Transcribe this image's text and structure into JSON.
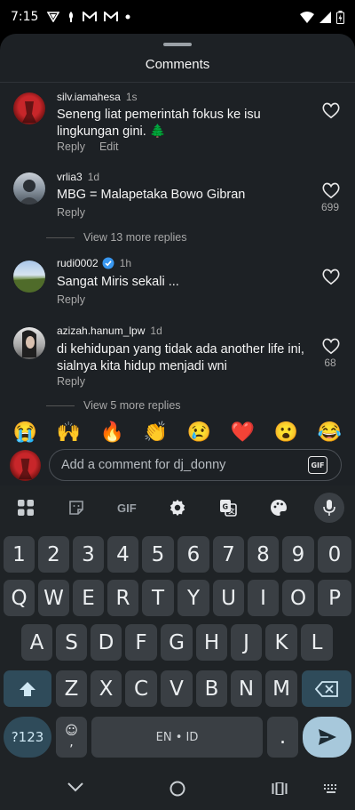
{
  "status": {
    "time": "7:15",
    "left_icons": [
      "vpn-icon",
      "notification-icon",
      "gmail-icon",
      "gmail-icon",
      "dot-icon"
    ]
  },
  "sheet": {
    "title": "Comments"
  },
  "comments": [
    {
      "user": "silv.iamahesa",
      "time": "1s",
      "text": "Seneng liat pemerintah fokus ke isu lingkungan gini. 🌲",
      "reply": "Reply",
      "edit": "Edit",
      "likes": ""
    },
    {
      "user": "vrlia3",
      "time": "1d",
      "text": "MBG = Malapetaka Bowo Gibran",
      "reply": "Reply",
      "likes": "699",
      "view_replies": "View 13 more replies"
    },
    {
      "user": "rudi0002",
      "time": "1h",
      "text": "Sangat Miris sekali ...",
      "reply": "Reply",
      "likes": "",
      "verified": true
    },
    {
      "user": "azizah.hanum_lpw",
      "time": "1d",
      "text": "di kehidupan yang tidak ada another life ini, sialnya kita hidup menjadi wni",
      "reply": "Reply",
      "likes": "68",
      "view_replies": "View 5 more replies"
    }
  ],
  "emojis": [
    "😭",
    "🙌",
    "🔥",
    "👏",
    "😢",
    "❤️",
    "😮",
    "😂"
  ],
  "input": {
    "placeholder": "Add a comment for dj_donny",
    "gif_label": "GIF"
  },
  "keyboard": {
    "toolbar": [
      "apps-icon",
      "sticker-icon",
      "GIF",
      "settings-icon",
      "translate-icon",
      "palette-icon",
      "mic-icon"
    ],
    "gif_text": "GIF",
    "row_numbers": [
      "1",
      "2",
      "3",
      "4",
      "5",
      "6",
      "7",
      "8",
      "9",
      "0"
    ],
    "row1": [
      "Q",
      "W",
      "E",
      "R",
      "T",
      "Y",
      "U",
      "I",
      "O",
      "P"
    ],
    "row2": [
      "A",
      "S",
      "D",
      "F",
      "G",
      "H",
      "J",
      "K",
      "L"
    ],
    "row3": [
      "Z",
      "X",
      "C",
      "V",
      "B",
      "N",
      "M"
    ],
    "symbols_key": "?123",
    "comma_key": ",",
    "space_key": "EN • ID",
    "period_key": "."
  },
  "colors": {
    "sheet_bg": "#1d2125",
    "key_bg": "#3a3f44",
    "special_key": "#2f4b5a",
    "enter_key": "#a7c8db"
  }
}
